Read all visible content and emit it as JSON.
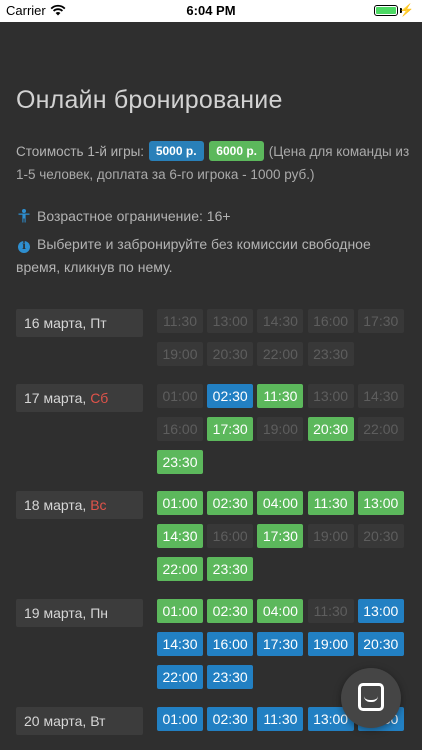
{
  "status_bar": {
    "carrier": "Carrier",
    "time": "6:04 PM",
    "icons": [
      "wifi-icon",
      "battery-icon",
      "charging-bolt-icon"
    ]
  },
  "page": {
    "title": "Онлайн бронирование",
    "price_label": "Стоимость 1-й игры:",
    "price_badges": [
      {
        "text": "5000 р.",
        "color": "#2980b9"
      },
      {
        "text": "6000 р.",
        "color": "#5cb85c"
      }
    ],
    "price_note": "(Цена для команды из 1-5 человек, доплата за 6-го игрока - 1000 руб.)",
    "age_text": "Возрастное ограничение: 16+",
    "info_text": "Выберите и забронируйте без комиссии свободное время, кликнув по нему."
  },
  "colors": {
    "background": "#2f2f2f",
    "slot_green": "#5cb85c",
    "slot_blue": "#2280c3",
    "slot_unavailable": "#383838",
    "weekend_red": "#e0534a"
  },
  "days": [
    {
      "date": "16 марта,",
      "weekday": "Пт",
      "weekend": false,
      "slots": [
        {
          "time": "11:30",
          "state": "off"
        },
        {
          "time": "13:00",
          "state": "off"
        },
        {
          "time": "14:30",
          "state": "off"
        },
        {
          "time": "16:00",
          "state": "off"
        },
        {
          "time": "17:30",
          "state": "off"
        },
        {
          "time": "19:00",
          "state": "off"
        },
        {
          "time": "20:30",
          "state": "off"
        },
        {
          "time": "22:00",
          "state": "off"
        },
        {
          "time": "23:30",
          "state": "off"
        }
      ]
    },
    {
      "date": "17 марта,",
      "weekday": "Сб",
      "weekend": true,
      "slots": [
        {
          "time": "01:00",
          "state": "off"
        },
        {
          "time": "02:30",
          "state": "blue"
        },
        {
          "time": "11:30",
          "state": "green"
        },
        {
          "time": "13:00",
          "state": "off"
        },
        {
          "time": "14:30",
          "state": "off"
        },
        {
          "time": "16:00",
          "state": "off"
        },
        {
          "time": "17:30",
          "state": "green"
        },
        {
          "time": "19:00",
          "state": "off"
        },
        {
          "time": "20:30",
          "state": "green"
        },
        {
          "time": "22:00",
          "state": "off"
        },
        {
          "time": "23:30",
          "state": "green"
        }
      ]
    },
    {
      "date": "18 марта,",
      "weekday": "Вс",
      "weekend": true,
      "slots": [
        {
          "time": "01:00",
          "state": "green"
        },
        {
          "time": "02:30",
          "state": "green"
        },
        {
          "time": "04:00",
          "state": "green"
        },
        {
          "time": "11:30",
          "state": "green"
        },
        {
          "time": "13:00",
          "state": "green"
        },
        {
          "time": "14:30",
          "state": "green"
        },
        {
          "time": "16:00",
          "state": "off"
        },
        {
          "time": "17:30",
          "state": "green"
        },
        {
          "time": "19:00",
          "state": "off"
        },
        {
          "time": "20:30",
          "state": "off"
        },
        {
          "time": "22:00",
          "state": "green"
        },
        {
          "time": "23:30",
          "state": "green"
        }
      ]
    },
    {
      "date": "19 марта,",
      "weekday": "Пн",
      "weekend": false,
      "slots": [
        {
          "time": "01:00",
          "state": "green"
        },
        {
          "time": "02:30",
          "state": "green"
        },
        {
          "time": "04:00",
          "state": "green"
        },
        {
          "time": "11:30",
          "state": "off"
        },
        {
          "time": "13:00",
          "state": "blue"
        },
        {
          "time": "14:30",
          "state": "blue"
        },
        {
          "time": "16:00",
          "state": "blue"
        },
        {
          "time": "17:30",
          "state": "blue"
        },
        {
          "time": "19:00",
          "state": "blue"
        },
        {
          "time": "20:30",
          "state": "blue"
        },
        {
          "time": "22:00",
          "state": "blue"
        },
        {
          "time": "23:30",
          "state": "blue"
        }
      ]
    },
    {
      "date": "20 марта,",
      "weekday": "Вт",
      "weekend": false,
      "slots": [
        {
          "time": "01:00",
          "state": "blue"
        },
        {
          "time": "02:30",
          "state": "blue"
        },
        {
          "time": "11:30",
          "state": "blue"
        },
        {
          "time": "13:00",
          "state": "blue"
        },
        {
          "time": "14:30",
          "state": "blue"
        }
      ]
    }
  ]
}
